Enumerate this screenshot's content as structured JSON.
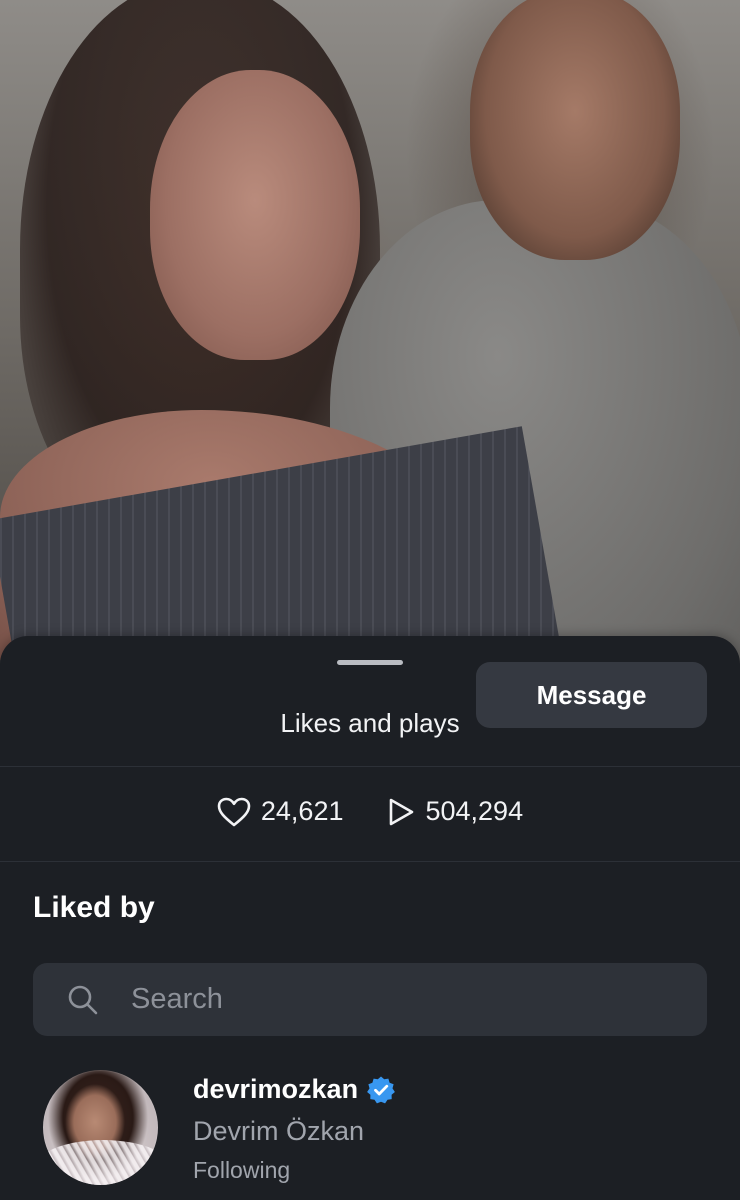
{
  "sheet": {
    "title": "Likes and plays"
  },
  "stats": {
    "likes": "24,621",
    "plays": "504,294",
    "likes_icon": "heart-icon",
    "plays_icon": "play-icon"
  },
  "liked_by": {
    "title": "Liked by",
    "search_placeholder": "Search",
    "search_icon": "search-icon"
  },
  "users": [
    {
      "username": "devrimozkan",
      "full_name": "Devrim Özkan",
      "status": "Following",
      "verified": true,
      "verified_color": "#3897f0",
      "action_label": "Message"
    }
  ],
  "colors": {
    "sheet_bg": "#1c1f24",
    "search_bg": "#2e3239",
    "button_bg": "#353941",
    "secondary_text": "#a1a5ad"
  }
}
